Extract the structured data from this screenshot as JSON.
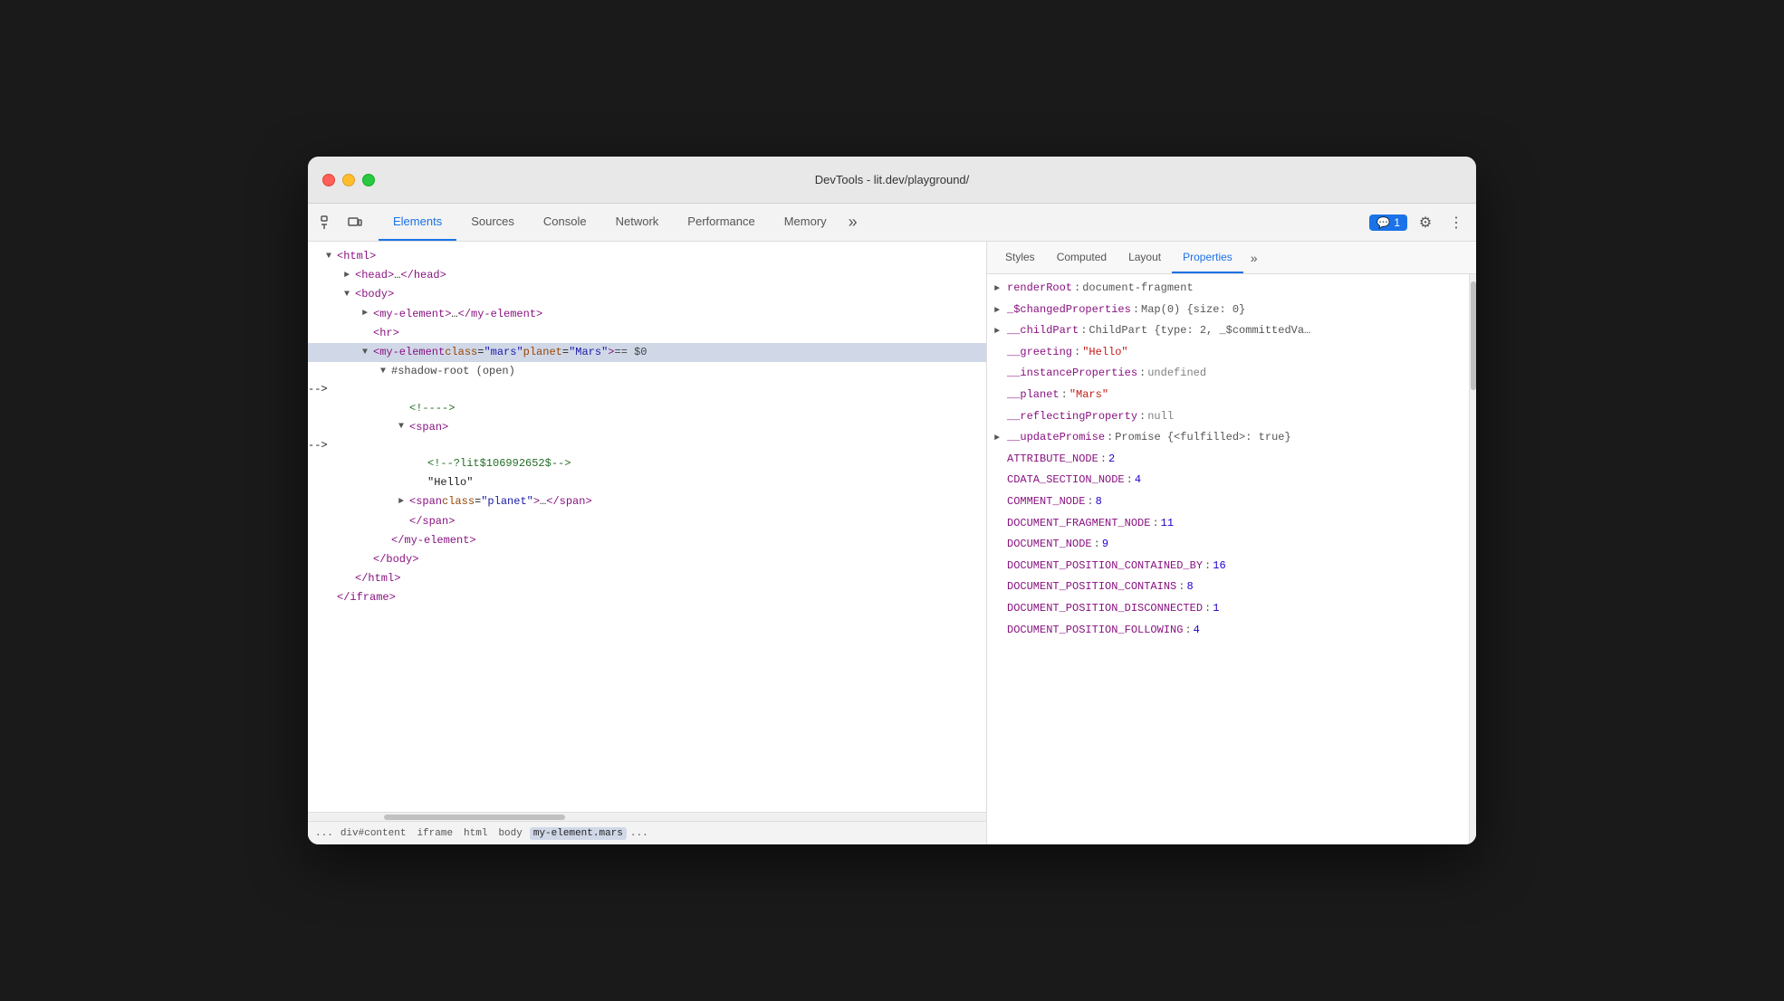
{
  "window": {
    "title": "DevTools - lit.dev/playground/"
  },
  "toolbar": {
    "tabs": [
      {
        "label": "Elements",
        "active": true
      },
      {
        "label": "Sources",
        "active": false
      },
      {
        "label": "Console",
        "active": false
      },
      {
        "label": "Network",
        "active": false
      },
      {
        "label": "Performance",
        "active": false
      },
      {
        "label": "Memory",
        "active": false
      }
    ],
    "tab_overflow": "»",
    "console_badge_icon": "💬",
    "console_badge_count": "1",
    "settings_icon": "⚙",
    "more_icon": "⋮"
  },
  "elements_tree": [
    {
      "indent": "indent1",
      "content": "▼ <html>",
      "selected": false
    },
    {
      "indent": "indent2",
      "content": "► <head>…</head>",
      "selected": false
    },
    {
      "indent": "indent2",
      "content": "▼ <body>",
      "selected": false
    },
    {
      "indent": "indent3",
      "content": "► <my-element>…</my-element>",
      "selected": false
    },
    {
      "indent": "indent3",
      "content": "<hr>",
      "selected": false
    },
    {
      "indent": "indent3",
      "content": "▼ <my-element class=\"mars\" planet=\"Mars\"> == $0",
      "selected": true
    },
    {
      "indent": "indent4",
      "content": "▼ #shadow-root (open)",
      "selected": false
    },
    {
      "indent": "indent5",
      "content": "<!---->",
      "selected": false
    },
    {
      "indent": "indent5",
      "content": "▼ <span>",
      "selected": false
    },
    {
      "indent": "indent6",
      "content": "<!--?lit$106992652$-->",
      "selected": false
    },
    {
      "indent": "indent6",
      "content": "\"Hello\"",
      "selected": false
    },
    {
      "indent": "indent5",
      "content": "► <span class=\"planet\">…</span>",
      "selected": false
    },
    {
      "indent": "indent5",
      "content": "</span>",
      "selected": false
    },
    {
      "indent": "indent4",
      "content": "</my-element>",
      "selected": false
    },
    {
      "indent": "indent3",
      "content": "</body>",
      "selected": false
    },
    {
      "indent": "indent2",
      "content": "</html>",
      "selected": false
    },
    {
      "indent": "indent1",
      "content": "</iframe>",
      "selected": false
    }
  ],
  "breadcrumb": {
    "ellipsis": "...",
    "items": [
      {
        "label": "div#content",
        "active": false
      },
      {
        "label": "iframe",
        "active": false
      },
      {
        "label": "html",
        "active": false
      },
      {
        "label": "body",
        "active": false
      },
      {
        "label": "my-element.mars",
        "active": true
      }
    ],
    "more": "..."
  },
  "properties_tabs": [
    {
      "label": "Styles",
      "active": false
    },
    {
      "label": "Computed",
      "active": false
    },
    {
      "label": "Layout",
      "active": false
    },
    {
      "label": "Properties",
      "active": true
    }
  ],
  "properties_tab_overflow": "»",
  "properties": [
    {
      "expandable": true,
      "key": "renderRoot",
      "colon": ":",
      "value": "document-fragment",
      "type": "obj"
    },
    {
      "expandable": true,
      "key": "_$changedProperties",
      "colon": ":",
      "value": "Map(0) {size: 0}",
      "type": "obj"
    },
    {
      "expandable": true,
      "key": "__childPart",
      "colon": ":",
      "value": "ChildPart {type: 2, _$committedVa…",
      "type": "obj"
    },
    {
      "expandable": false,
      "key": "__greeting",
      "colon": ":",
      "value": "\"Hello\"",
      "type": "string"
    },
    {
      "expandable": false,
      "key": "__instanceProperties",
      "colon": ":",
      "value": "undefined",
      "type": "undef"
    },
    {
      "expandable": false,
      "key": "__planet",
      "colon": ":",
      "value": "\"Mars\"",
      "type": "string"
    },
    {
      "expandable": false,
      "key": "__reflectingProperty",
      "colon": ":",
      "value": "null",
      "type": "null"
    },
    {
      "expandable": true,
      "key": "__updatePromise",
      "colon": ":",
      "value": "Promise {<fulfilled>: true}",
      "type": "obj"
    },
    {
      "expandable": false,
      "key": "ATTRIBUTE_NODE",
      "colon": ":",
      "value": "2",
      "type": "num"
    },
    {
      "expandable": false,
      "key": "CDATA_SECTION_NODE",
      "colon": ":",
      "value": "4",
      "type": "num"
    },
    {
      "expandable": false,
      "key": "COMMENT_NODE",
      "colon": ":",
      "value": "8",
      "type": "num"
    },
    {
      "expandable": false,
      "key": "DOCUMENT_FRAGMENT_NODE",
      "colon": ":",
      "value": "11",
      "type": "num"
    },
    {
      "expandable": false,
      "key": "DOCUMENT_NODE",
      "colon": ":",
      "value": "9",
      "type": "num"
    },
    {
      "expandable": false,
      "key": "DOCUMENT_POSITION_CONTAINED_BY",
      "colon": ":",
      "value": "16",
      "type": "num"
    },
    {
      "expandable": false,
      "key": "DOCUMENT_POSITION_CONTAINS",
      "colon": ":",
      "value": "8",
      "type": "num"
    },
    {
      "expandable": false,
      "key": "DOCUMENT_POSITION_DISCONNECTED",
      "colon": ":",
      "value": "1",
      "type": "num"
    },
    {
      "expandable": false,
      "key": "DOCUMENT_POSITION_FOLLOWING",
      "colon": ":",
      "value": "4",
      "type": "num"
    }
  ]
}
